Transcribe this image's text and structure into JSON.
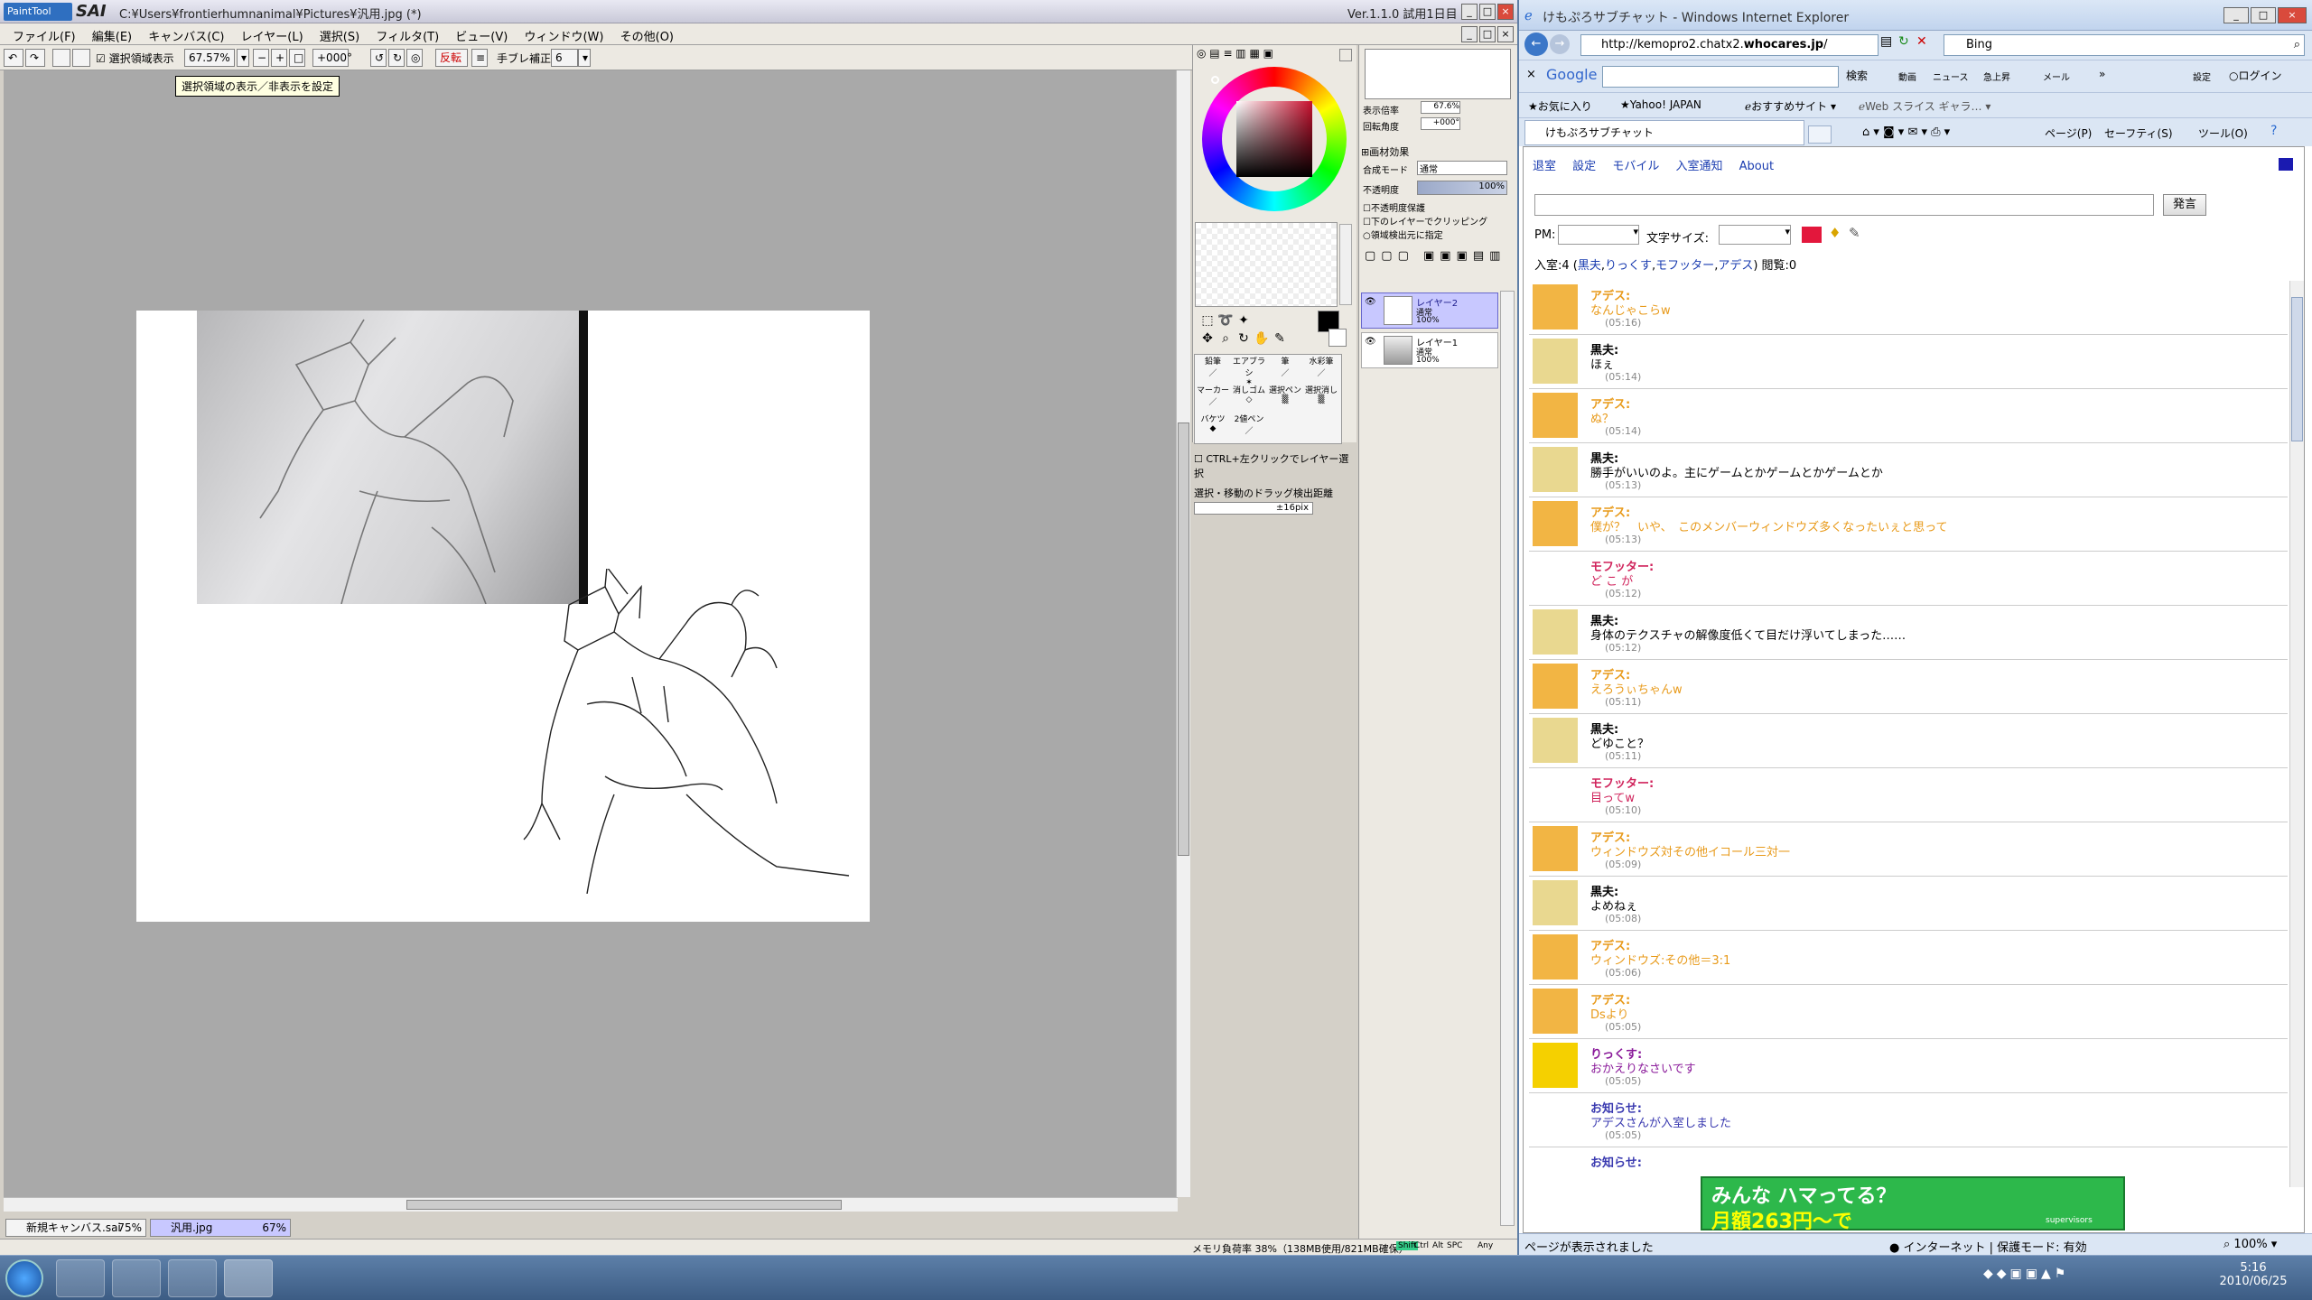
{
  "sai": {
    "logo": "PaintTool",
    "name": "SAI",
    "path": "C:¥Users¥frontierhumnanimal¥Pictures¥汎用.jpg (*)",
    "version": "Ver.1.1.0  試用1日目",
    "menu": [
      "ファイル(F)",
      "編集(E)",
      "キャンバス(C)",
      "レイヤー(L)",
      "選択(S)",
      "フィルタ(T)",
      "ビュー(V)",
      "ウィンドウ(W)",
      "その他(O)"
    ],
    "toolbar": {
      "selection_toggle": "選択領域表示",
      "zoom": "67.57%",
      "rotation": "+000°",
      "flip": "反転",
      "stabilizer_label": "手ブレ補正",
      "stabilizer_value": "6"
    },
    "tooltip": "選択領域の表示／非表示を設定",
    "doc_tabs": [
      {
        "name": "新規キャンバス.sai",
        "zoom": "75%"
      },
      {
        "name": "汎用.jpg",
        "zoom": "67%"
      }
    ],
    "status": "メモリ負荷率 38%（138MB使用/821MB確保）",
    "status_keys": [
      "Shift",
      "Ctrl",
      "Alt",
      "SPC",
      "Any"
    ],
    "tool_labels": [
      "鉛筆",
      "エアブラシ",
      "筆",
      "水彩筆",
      "マーカー",
      "消しゴム",
      "選択ペン",
      "選択消し",
      "バケツ",
      "2値ペン"
    ],
    "brush_options": {
      "ctrl_click": "CTRL+左クリックでレイヤー選択",
      "drag_label": "選択・移動のドラッグ検出距離",
      "drag_value": "±16pix"
    },
    "layer_panel": {
      "zoom_label": "表示倍率",
      "zoom_value": "67.6%",
      "angle_label": "回転角度",
      "angle_value": "+000°",
      "effects": "画材効果",
      "blend_label": "合成モード",
      "blend_value": "通常",
      "opacity_label": "不透明度",
      "opacity_value": "100%",
      "checks": [
        "不透明度保護",
        "下のレイヤーでクリッピング",
        "領域検出元に指定"
      ],
      "layers": [
        {
          "name": "レイヤー2",
          "mode": "通常",
          "opacity": "100%"
        },
        {
          "name": "レイヤー1",
          "mode": "通常",
          "opacity": "100%"
        }
      ]
    }
  },
  "ie": {
    "title": "けもぷろサブチャット - Windows Internet Explorer",
    "url_prefix": "http://kemopro2.chatx2.",
    "url_domain": "whocares.jp",
    "url_suffix": "/",
    "search_engine": "Bing",
    "google": {
      "logo": "Google",
      "search_button": "検索",
      "buttons": [
        "動画",
        "ニュース",
        "急上昇",
        "メール"
      ],
      "settings": "設定",
      "login": "ログイン"
    },
    "favorites": {
      "label": "お気に入り",
      "items": [
        "Yahoo! JAPAN",
        "おすすめサイト",
        "Web スライス ギャラ…"
      ]
    },
    "tab_title": "けもぷろサブチャット",
    "commands": [
      "ページ(P)",
      "セーフティ(S)",
      "ツール(O)"
    ],
    "chat": {
      "nav": [
        "退室",
        "設定",
        "モバイル",
        "入室通知",
        "About"
      ],
      "send": "発言",
      "pm_label": "PM:",
      "font_label": "文字サイズ:",
      "room_prefix": "入室:4 (",
      "members": [
        "黒夫",
        "りっくす",
        "モフッター",
        "アデス"
      ],
      "room_suffix": ") 閲覧:0",
      "messages": [
        {
          "name": "アデス:",
          "text": "なんじゃこらw",
          "time": "(05:16)",
          "color": "#e89a1a",
          "avatar": "wolf"
        },
        {
          "name": "黒夫:",
          "text": "ほぇ",
          "time": "(05:14)",
          "color": "#000000",
          "avatar": "blond"
        },
        {
          "name": "アデス:",
          "text": "ぬ？",
          "time": "(05:14)",
          "color": "#e89a1a",
          "avatar": "wolf"
        },
        {
          "name": "黒夫:",
          "text": "勝手がいいのよ。主にゲームとかゲームとかゲームとか",
          "time": "(05:13)",
          "color": "#000000",
          "avatar": "blond"
        },
        {
          "name": "アデス:",
          "text": "僕が？　いや、　このメンバーウィンドウズ多くなったいぇと思って",
          "time": "(05:13)",
          "color": "#e89a1a",
          "avatar": "wolf"
        },
        {
          "name": "モフッター:",
          "text": "ど こ が",
          "time": "(05:12)",
          "color": "#d0245c",
          "avatar": "none"
        },
        {
          "name": "黒夫:",
          "text": "身体のテクスチャの解像度低くて目だけ浮いてしまった……",
          "time": "(05:12)",
          "color": "#000000",
          "avatar": "blond"
        },
        {
          "name": "アデス:",
          "text": "えろうぃちゃんw",
          "time": "(05:11)",
          "color": "#e89a1a",
          "avatar": "wolf"
        },
        {
          "name": "黒夫:",
          "text": "どゆこと？",
          "time": "(05:11)",
          "color": "#000000",
          "avatar": "blond"
        },
        {
          "name": "モフッター:",
          "text": "目ってw",
          "time": "(05:10)",
          "color": "#d0245c",
          "avatar": "none"
        },
        {
          "name": "アデス:",
          "text": "ウィンドウズ対その他イコール三対一",
          "time": "(05:09)",
          "color": "#e89a1a",
          "avatar": "wolf"
        },
        {
          "name": "黒夫:",
          "text": "よめねぇ",
          "time": "(05:08)",
          "color": "#000000",
          "avatar": "blond"
        },
        {
          "name": "アデス:",
          "text": "ウィンドウズ:その他＝3:1",
          "time": "(05:06)",
          "color": "#e89a1a",
          "avatar": "wolf"
        },
        {
          "name": "アデス:",
          "text": "Dsより",
          "time": "(05:05)",
          "color": "#e89a1a",
          "avatar": "wolf"
        },
        {
          "name": "りっくす:",
          "text": "おかえりなさいです",
          "time": "(05:05)",
          "color": "#8a1a9a",
          "avatar": "yellow"
        },
        {
          "name": "お知らせ:",
          "text": "アデスさんが入室しました",
          "time": "(05:05)",
          "color": "#3a3ab0",
          "avatar": "none"
        },
        {
          "name": "お知らせ:",
          "text": "",
          "time": "",
          "color": "#3a3ab0",
          "avatar": "none"
        }
      ],
      "banner_line1": "みんな ハマってる？",
      "banner_line2": "月額263円～で",
      "banner_logo": "supervisors"
    },
    "status": "ページが表示されました",
    "zone": "インターネット | 保護モード: 有効",
    "zoom": "100%"
  },
  "taskbar": {
    "time": "5:16",
    "date": "2010/06/25"
  },
  "colors": {
    "primary": "#000000",
    "secondary": "#ffffff",
    "chat_color_swatch": "#e3173c",
    "link": "#1a3cb0",
    "selected_layer": "#c8c8ff"
  }
}
